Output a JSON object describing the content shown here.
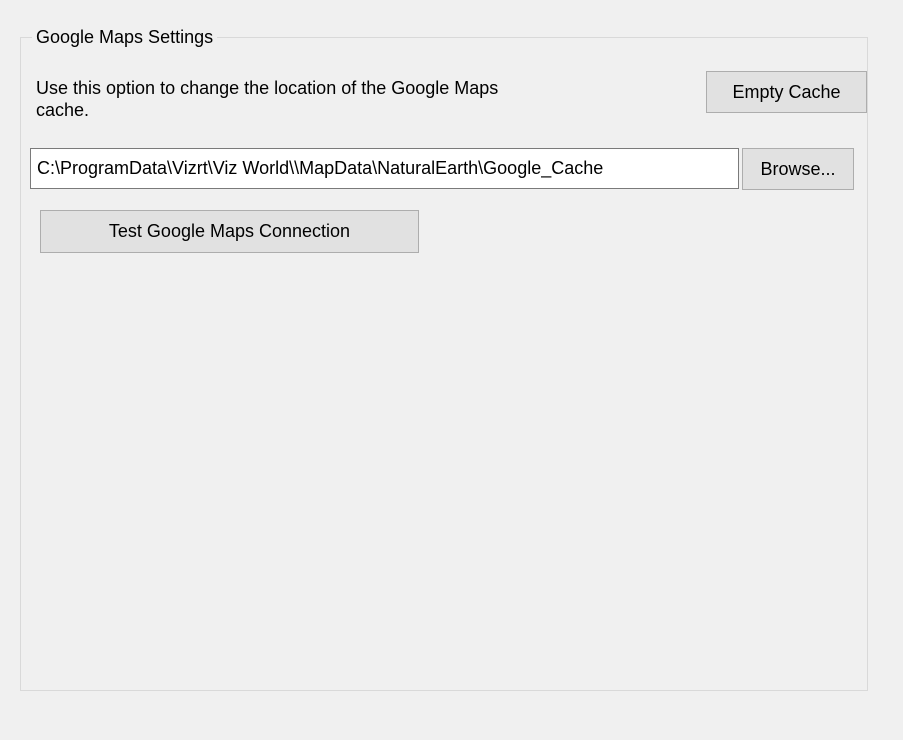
{
  "group": {
    "title": "Google Maps Settings"
  },
  "cache": {
    "description": "Use this option to change the location of the Google Maps cache.",
    "empty_cache_label": "Empty Cache",
    "path_value": "C:\\ProgramData\\Vizrt\\Viz World\\\\MapData\\NaturalEarth\\Google_Cache",
    "browse_label": "Browse..."
  },
  "connection": {
    "test_label": "Test Google Maps Connection"
  }
}
